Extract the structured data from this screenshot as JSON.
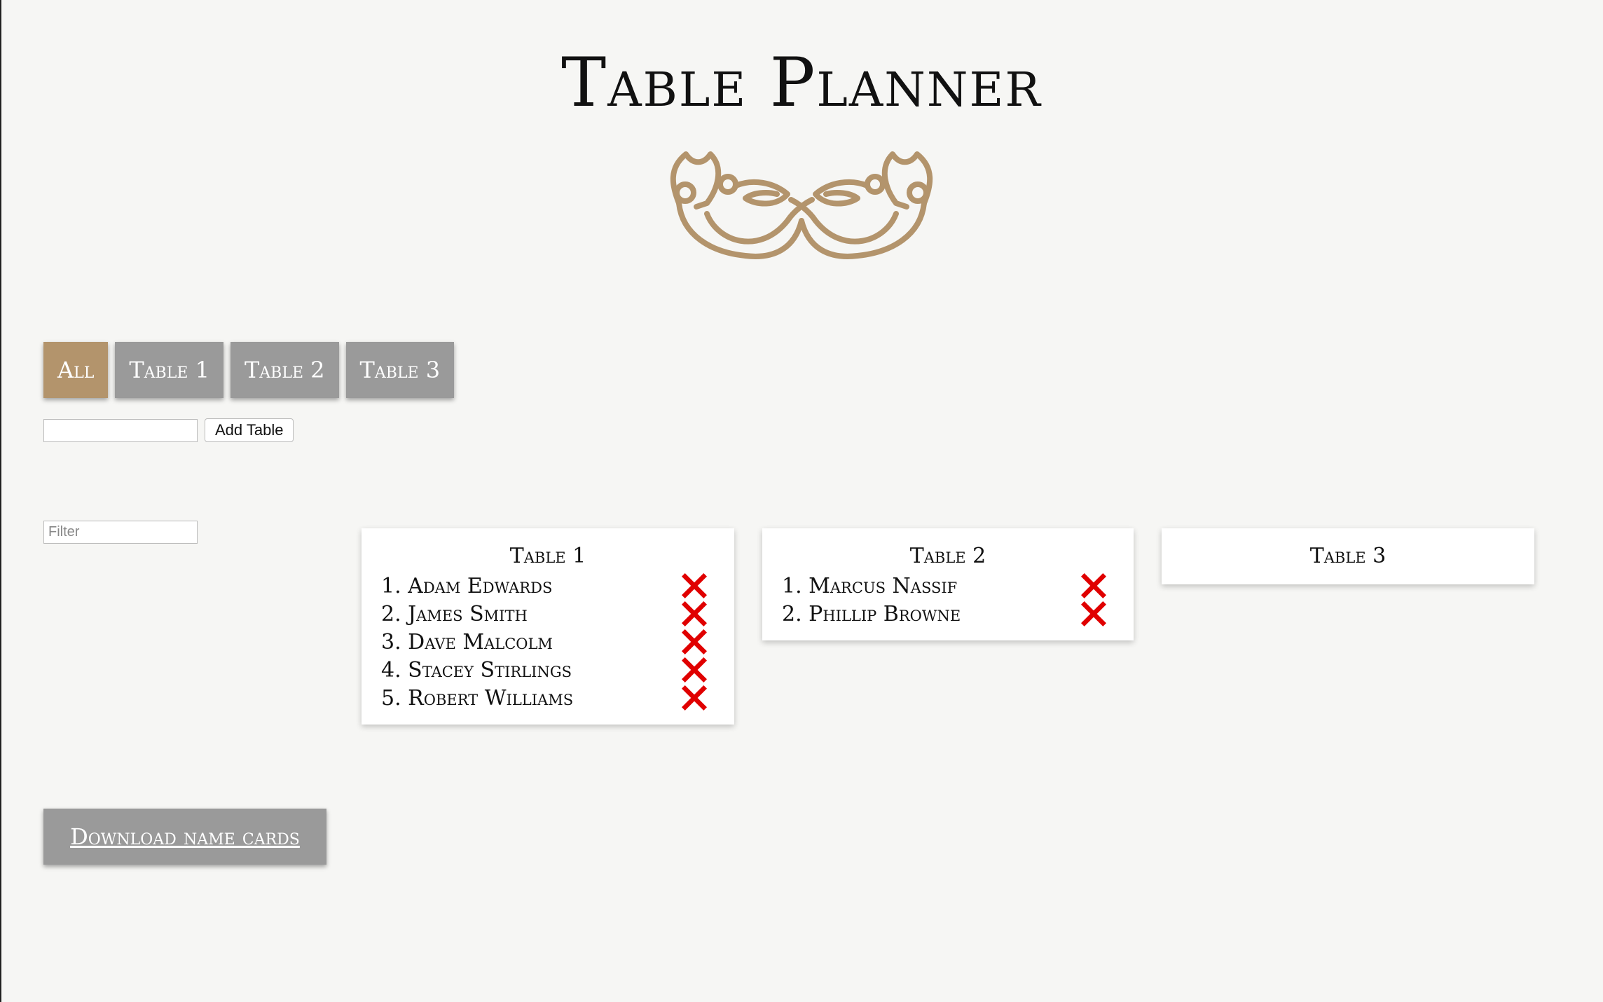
{
  "header": {
    "title": "Table Planner",
    "ornament_color": "#b3946c"
  },
  "tabs": [
    {
      "label": "All",
      "active": true
    },
    {
      "label": "Table 1",
      "active": false
    },
    {
      "label": "Table 2",
      "active": false
    },
    {
      "label": "Table 3",
      "active": false
    }
  ],
  "add_table": {
    "input_value": "",
    "button_label": "Add Table"
  },
  "filter": {
    "placeholder": "Filter",
    "value": ""
  },
  "tables": [
    {
      "title": "Table 1",
      "guests": [
        "1. Adam Edwards",
        "2. James Smith",
        "3. Dave Malcolm",
        "4. Stacey Stirlings",
        "5. Robert Williams"
      ]
    },
    {
      "title": "Table 2",
      "guests": [
        "1. Marcus Nassif",
        "2. Phillip Browne"
      ]
    },
    {
      "title": "Table 3",
      "guests": []
    }
  ],
  "download": {
    "label": "Download name cards"
  },
  "colors": {
    "accent": "#b3946c",
    "tab_inactive": "#9a9a9a",
    "remove": "#e00000",
    "background": "#f6f6f4"
  },
  "icons": {
    "remove": "close-icon",
    "ornament": "thistle-ornament-icon"
  }
}
